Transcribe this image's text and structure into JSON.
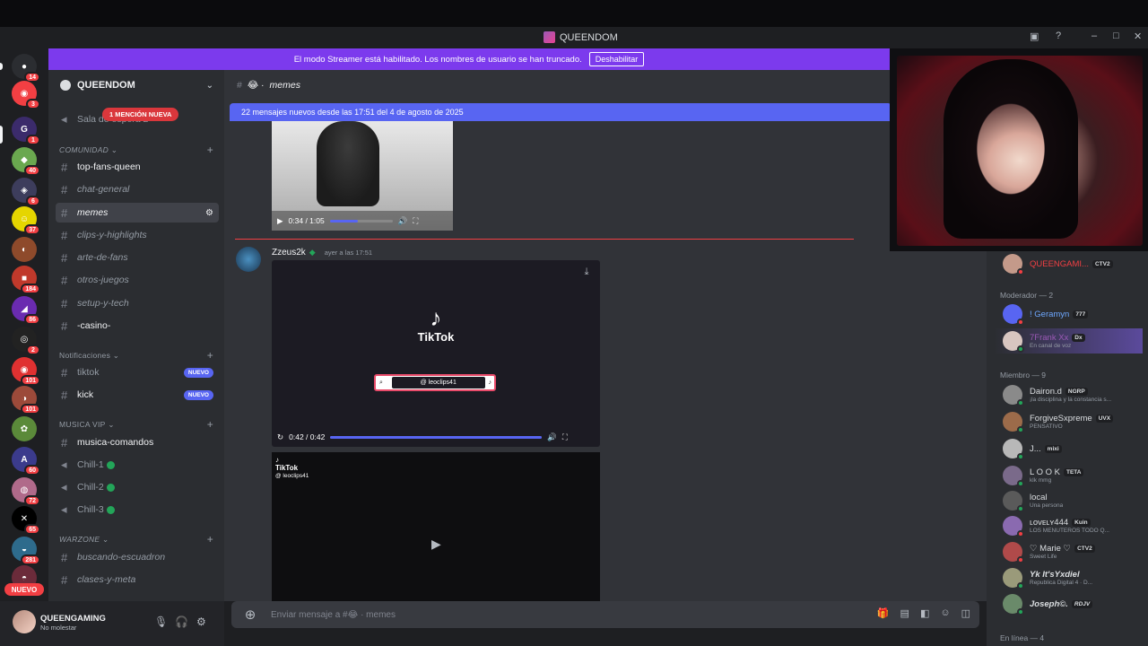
{
  "window": {
    "title": "QUEENDOM"
  },
  "banner": {
    "text": "El modo Streamer está habilitado. Los nombres de usuario se han truncado.",
    "button": "Deshabilitar"
  },
  "rail": {
    "badges": [
      "14",
      "3",
      "1",
      "40",
      "6",
      "37",
      "184",
      "86",
      "2",
      "101",
      "101",
      "60",
      "72",
      "65",
      "281"
    ],
    "new_label": "NUEVO"
  },
  "server": {
    "name": "QUEENDOM",
    "mention_pill": "1 MENCIÓN NUEVA",
    "channels": {
      "sala_espera": "Sala de espera 2",
      "cat_comunidad": "COMUNIDAD",
      "top_fans": "top-fans-queen",
      "chat_general": "chat-general",
      "memes": "memes",
      "clips": "clips-y-highlights",
      "arte": "arte-de-fans",
      "otros": "otros-juegos",
      "setup": "setup-y-tech",
      "casino": "-casino-",
      "cat_notif": "Notificaciones",
      "tiktok": "tiktok",
      "kick": "kick",
      "nuevo_tag": "NUEVO",
      "cat_musica": "MUSICA VIP",
      "musica_comandos": "musica-comandos",
      "chill1": "Chill-1",
      "chill2": "Chill-2",
      "chill3": "Chill-3",
      "cat_warzone": "WARZONE",
      "buscando": "buscando-escuadron",
      "clases": "clases-y-meta"
    }
  },
  "user": {
    "name": "QUEENGAMING",
    "status": "No molestar"
  },
  "chat": {
    "channel": "memes",
    "new_messages": "22 mensajes nuevos desde las 17:51 del 4 de agosto de 2025",
    "video1_time": "0:34 / 1:05",
    "video1_progress": 0.45,
    "author": "Zzeus2k",
    "timestamp": "ayer a las 17:51",
    "tiktok_word": "TikTok",
    "tiktok_handle": "@ leoclips41",
    "video2_time": "0:42 / 0:42",
    "video2_progress": 1.0,
    "video3_tk": "TikTok",
    "video3_handle": "@ leoclips41",
    "composer_placeholder": "Enviar mensaje a #😂 · memes"
  },
  "members": {
    "top_member": {
      "name": "QUEENGAMI...",
      "tag": "CTV2"
    },
    "section_mod": "Moderador — 2",
    "mods": [
      {
        "name": "! Geramyn",
        "tag": "777",
        "sub": ""
      },
      {
        "name": "7Frank Xx",
        "tag": "Dx",
        "sub": "En canal de voz"
      }
    ],
    "section_member": "Miembro — 9",
    "list": [
      {
        "name": "Dairon.d",
        "tag": "NGRP",
        "sub": "¡la disciplina y la constancia s..."
      },
      {
        "name": "ForgiveSxpreme",
        "tag": "UVX",
        "sub": "PENSATIVO"
      },
      {
        "name": "J...",
        "tag": "mixi",
        "sub": ""
      },
      {
        "name": "L O O K",
        "tag": "TETA",
        "sub": "klk mmg"
      },
      {
        "name": "local",
        "tag": "",
        "sub": "Una persona"
      },
      {
        "name": "ʟᴏᴠᴇʟʏ444",
        "tag": "Kuin",
        "sub": "LOS MENUTEROS TODO Q..."
      },
      {
        "name": "♡ Marie ♡",
        "tag": "CTV2",
        "sub": "Sweet Life"
      },
      {
        "name": "Yk It'sYxdiel",
        "tag": "",
        "sub": "Republica Digital 4 · D..."
      },
      {
        "name": "Joseph©.",
        "tag": "RDJV",
        "sub": ""
      }
    ],
    "section_online": "En línea — 4"
  },
  "colors": {
    "accent": "#5865f2",
    "streamer": "#7c3aed",
    "danger": "#f23f43",
    "online": "#23a559"
  }
}
